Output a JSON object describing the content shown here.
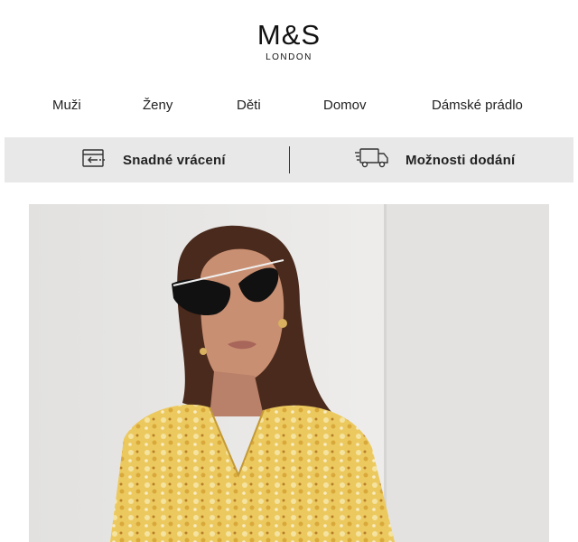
{
  "logo": {
    "main": "M&S",
    "sub": "LONDON"
  },
  "nav": {
    "items": [
      {
        "label": "Muži"
      },
      {
        "label": "Ženy"
      },
      {
        "label": "Děti"
      },
      {
        "label": "Domov"
      },
      {
        "label": "Dámské prádlo"
      }
    ]
  },
  "promo": {
    "returns_label": "Snadné vrácení",
    "delivery_label": "Možnosti dodání",
    "returns_icon": "return-box-icon",
    "delivery_icon": "delivery-truck-icon"
  },
  "colors": {
    "promo_bg": "#e8e8e8",
    "text": "#111111",
    "dress_yellow": "#e8c65a"
  }
}
